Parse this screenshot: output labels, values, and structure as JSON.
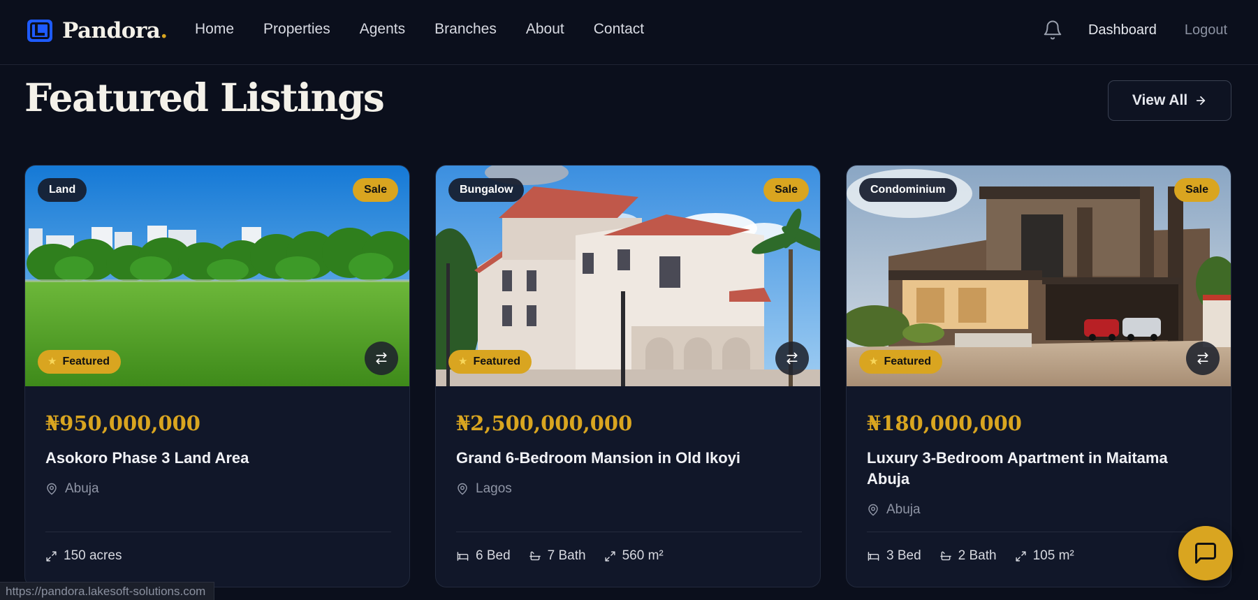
{
  "nav": {
    "brand": "Pandora",
    "brand_dot": ".",
    "links": [
      "Home",
      "Properties",
      "Agents",
      "Branches",
      "About",
      "Contact"
    ],
    "dashboard": "Dashboard",
    "logout": "Logout"
  },
  "section": {
    "title": "Featured Listings",
    "view_all": "View All"
  },
  "cards": [
    {
      "type": "Land",
      "listing": "Sale",
      "featured": "Featured",
      "price": "₦950,000,000",
      "title": "Asokoro Phase 3 Land Area",
      "location": "Abuja",
      "specs": [
        "150 acres"
      ]
    },
    {
      "type": "Bungalow",
      "listing": "Sale",
      "featured": "Featured",
      "price": "₦2,500,000,000",
      "title": "Grand 6-Bedroom Mansion in Old Ikoyi",
      "location": "Lagos",
      "specs": [
        "6 Bed",
        "7 Bath",
        "560 m²"
      ]
    },
    {
      "type": "Condominium",
      "listing": "Sale",
      "featured": "Featured",
      "price": "₦180,000,000",
      "title": "Luxury 3-Bedroom Apartment in Maitama Abuja",
      "location": "Abuja",
      "specs": [
        "3 Bed",
        "2 Bath",
        "105 m²"
      ]
    }
  ],
  "status_url": "https://pandora.lakesoft-solutions.com",
  "colors": {
    "background": "#0b0f1c",
    "card": "#111729",
    "accent_gold": "#d9a520",
    "brand_blue": "#1e5bff"
  }
}
